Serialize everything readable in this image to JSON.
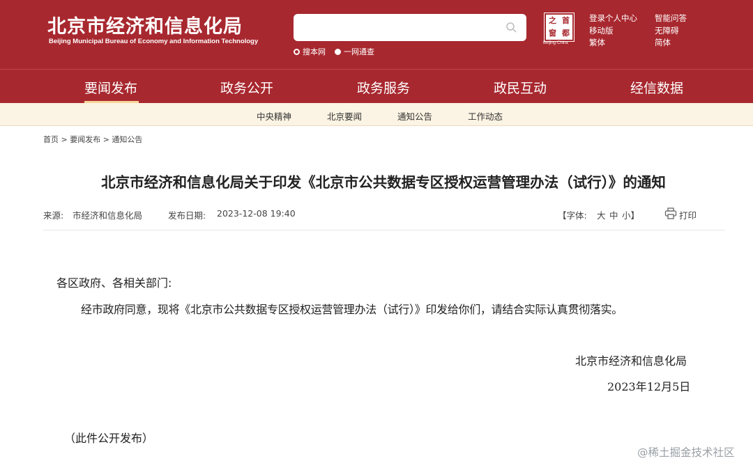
{
  "header": {
    "title_cn": "北京市经济和信息化局",
    "title_en": "Beijing Municipal Bureau of Economy and Information Technology",
    "search": {
      "placeholder": "",
      "option_site": "搜本网",
      "option_all": "一网通查"
    },
    "seal": {
      "chars": [
        "首",
        "都",
        "之",
        "窗"
      ],
      "subtitle": "Beijing·China"
    },
    "links": {
      "login": "登录个人中心",
      "mobile": "移动版",
      "traditional": "繁体",
      "smart_qa": "智能问答",
      "accessibility": "无障碍",
      "simplified": "简体"
    }
  },
  "nav": {
    "items": [
      "要闻发布",
      "政务公开",
      "政务服务",
      "政民互动",
      "经信数据"
    ],
    "active": "要闻发布"
  },
  "subnav": {
    "items": [
      "中央精神",
      "北京要闻",
      "通知公告",
      "工作动态"
    ]
  },
  "breadcrumb": "首页 > 要闻发布 > 通知公告",
  "article": {
    "title": "北京市经济和信息化局关于印发《北京市公共数据专区授权运营管理办法（试行）》的通知",
    "source_label": "来源:",
    "source": "市经济和信息化局",
    "date_label": "发布日期:",
    "date": "2023-12-08 19:40",
    "font_size_label": "【字体:",
    "font_large": "大",
    "font_medium": "中",
    "font_small": "小】",
    "print": "打印",
    "salutation": "各区政府、各相关部门:",
    "paragraph": "经市政府同意，现将《北京市公共数据专区授权运营管理办法（试行）》印发给你们，请结合实际认真贯彻落实。",
    "signature": "北京市经济和信息化局",
    "sign_date": "2023年12月5日",
    "publish_note": "（此件公开发布）"
  },
  "watermark": "@稀土掘金技术社区",
  "colors": {
    "brand_red": "#a8282f",
    "subnav_bg": "#fbf3e3",
    "active_underline": "#f7d79a"
  }
}
